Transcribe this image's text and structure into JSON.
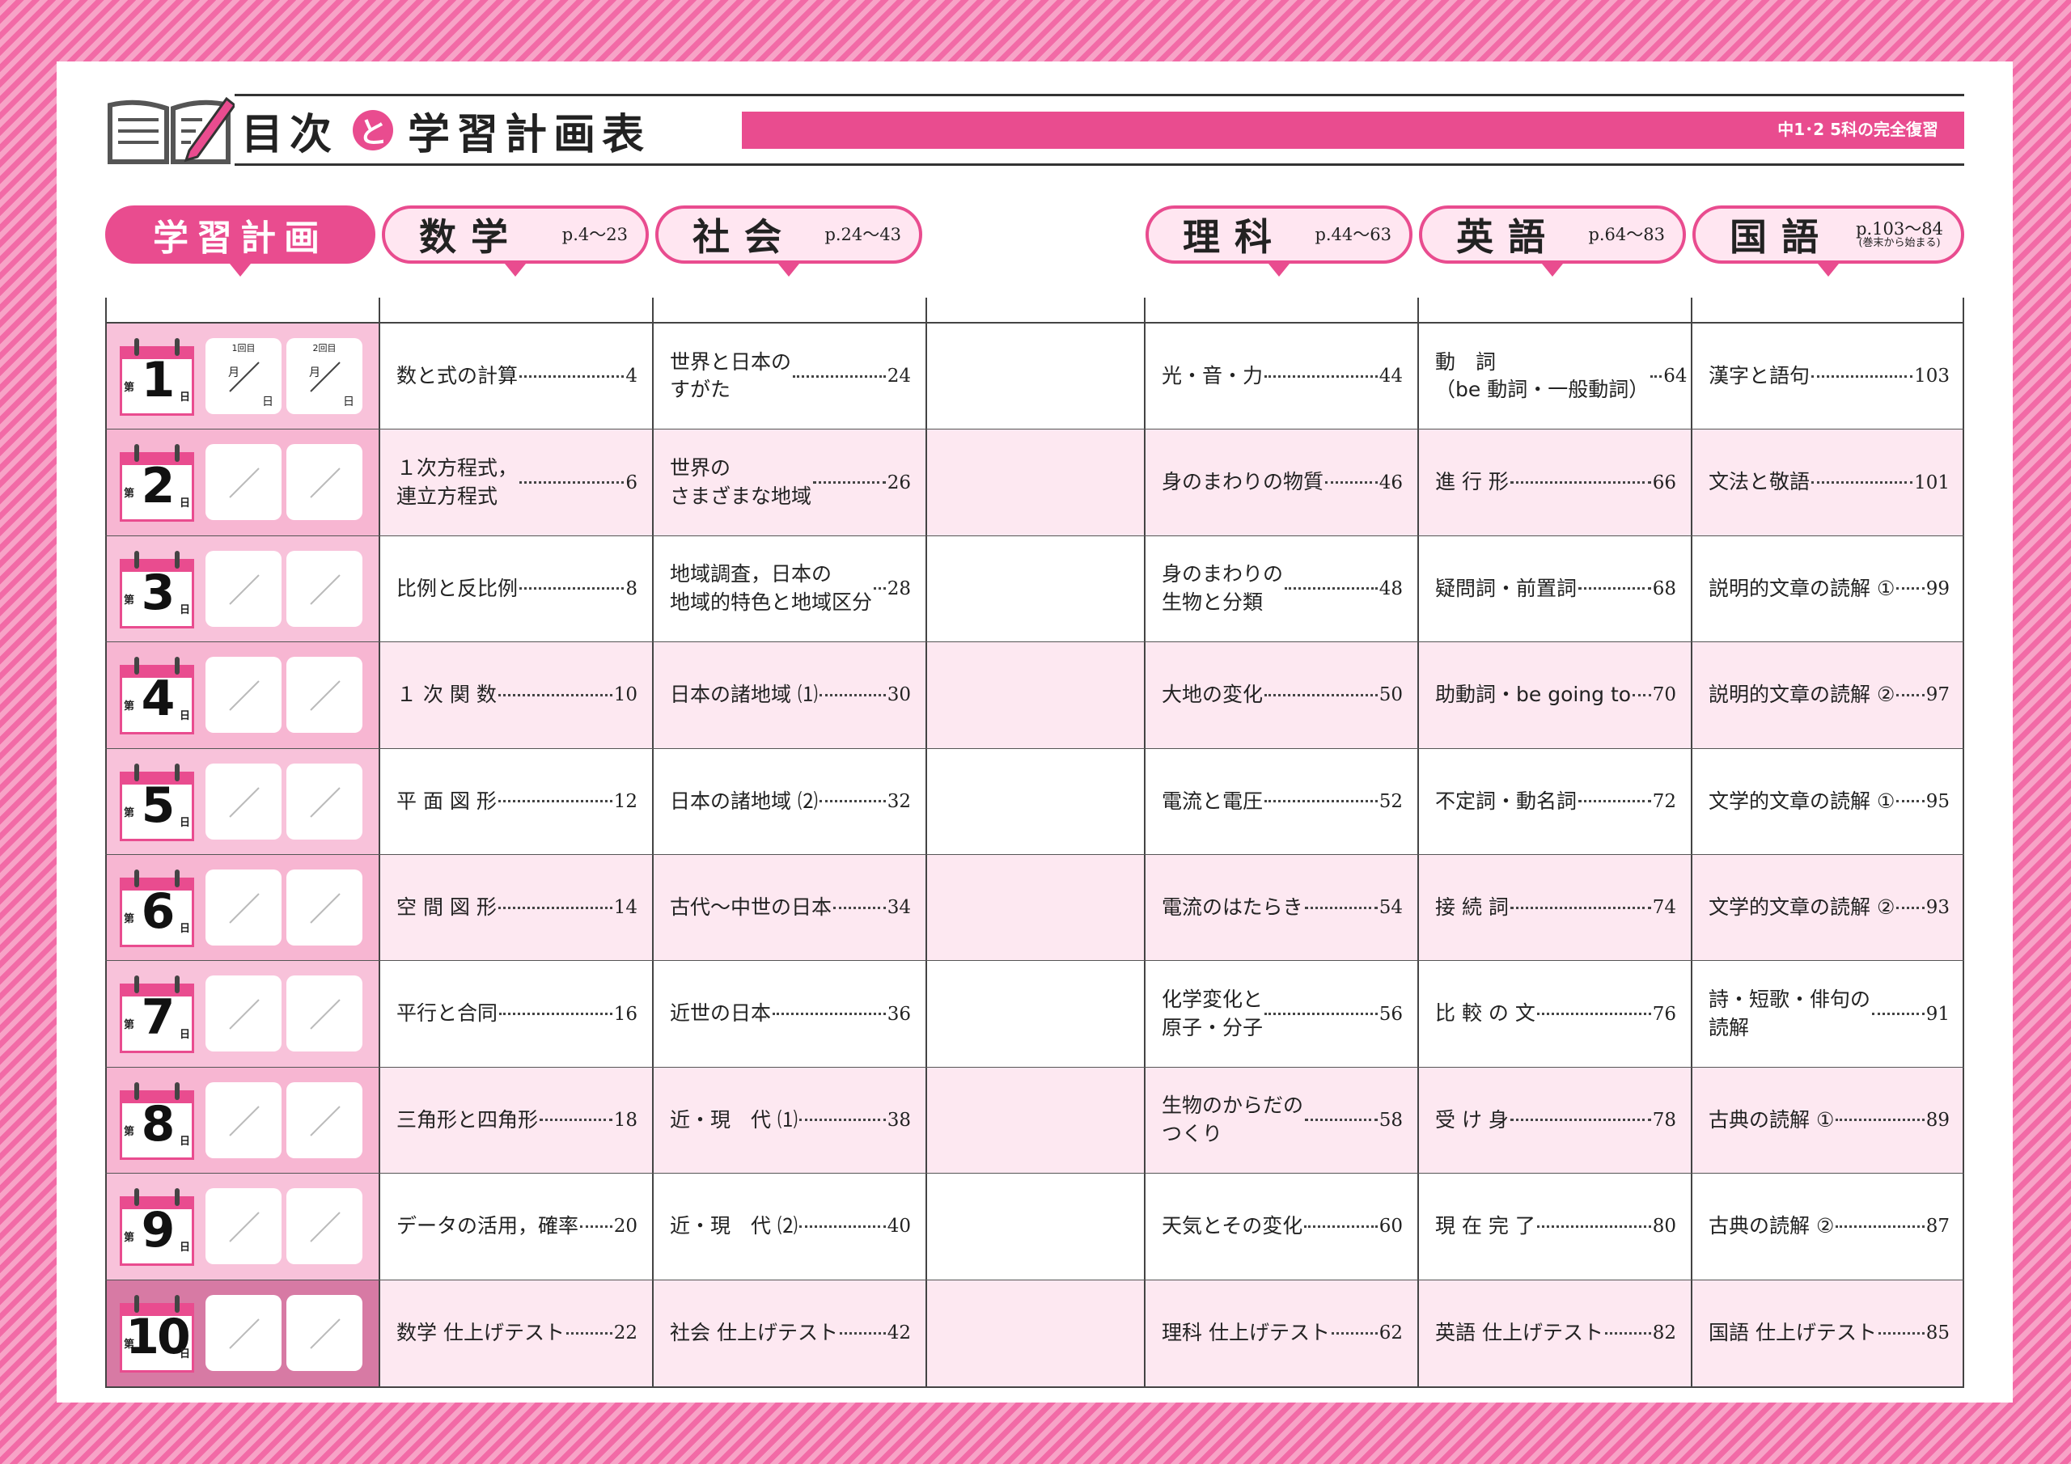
{
  "header": {
    "title_left": "目次",
    "title_mid": "と",
    "title_right": "学習計画表",
    "badge": "中1･2 5科の完全復習"
  },
  "plan_header": "学習計画",
  "date_labels": {
    "first": "1回目",
    "second": "2回目",
    "month": "月",
    "day": "日"
  },
  "calendar": {
    "prefix": "第",
    "suffix": "日"
  },
  "subjects": [
    {
      "name": "数学",
      "range": "p.4〜23",
      "note": ""
    },
    {
      "name": "社会",
      "range": "p.24〜43",
      "note": ""
    },
    {
      "name": "理科",
      "range": "p.44〜63",
      "note": ""
    },
    {
      "name": "英語",
      "range": "p.64〜83",
      "note": ""
    },
    {
      "name": "国語",
      "range": "p.103〜84",
      "note": "(巻末から始まる)"
    }
  ],
  "days": [
    "1",
    "2",
    "3",
    "4",
    "5",
    "6",
    "7",
    "8",
    "9",
    "10"
  ],
  "rows": [
    {
      "math": [
        "数と式の計算",
        "4"
      ],
      "social": [
        "世界と日本の\nすがた",
        "24"
      ],
      "science": [
        "光・音・力",
        "44"
      ],
      "english": [
        "動　詞\n（be 動詞・一般動詞）",
        "64"
      ],
      "japanese": [
        "漢字と語句",
        "103"
      ]
    },
    {
      "math": [
        "１次方程式，\n連立方程式",
        "6"
      ],
      "social": [
        "世界の\nさまざまな地域",
        "26"
      ],
      "science": [
        "身のまわりの物質",
        "46"
      ],
      "english": [
        "進 行 形",
        "66"
      ],
      "japanese": [
        "文法と敬語",
        "101"
      ]
    },
    {
      "math": [
        "比例と反比例",
        "8"
      ],
      "social": [
        "地域調査，日本の\n地域的特色と地域区分",
        "28"
      ],
      "science": [
        "身のまわりの\n生物と分類",
        "48"
      ],
      "english": [
        "疑問詞・前置詞",
        "68"
      ],
      "japanese": [
        "説明的文章の読解 ①",
        "99"
      ]
    },
    {
      "math": [
        "１ 次 関 数",
        "10"
      ],
      "social": [
        "日本の諸地域 ⑴",
        "30"
      ],
      "science": [
        "大地の変化",
        "50"
      ],
      "english": [
        "助動詞・be going to",
        "70"
      ],
      "japanese": [
        "説明的文章の読解 ②",
        "97"
      ]
    },
    {
      "math": [
        "平 面 図 形",
        "12"
      ],
      "social": [
        "日本の諸地域 ⑵",
        "32"
      ],
      "science": [
        "電流と電圧",
        "52"
      ],
      "english": [
        "不定詞・動名詞",
        "72"
      ],
      "japanese": [
        "文学的文章の読解 ①",
        "95"
      ]
    },
    {
      "math": [
        "空 間 図 形",
        "14"
      ],
      "social": [
        "古代〜中世の日本",
        "34"
      ],
      "science": [
        "電流のはたらき",
        "54"
      ],
      "english": [
        "接 続 詞",
        "74"
      ],
      "japanese": [
        "文学的文章の読解 ②",
        "93"
      ]
    },
    {
      "math": [
        "平行と合同",
        "16"
      ],
      "social": [
        "近世の日本",
        "36"
      ],
      "science": [
        "化学変化と\n原子・分子",
        "56"
      ],
      "english": [
        "比 較 の 文",
        "76"
      ],
      "japanese": [
        "詩・短歌・俳句の\n読解",
        "91"
      ]
    },
    {
      "math": [
        "三角形と四角形",
        "18"
      ],
      "social": [
        "近・現　代 ⑴",
        "38"
      ],
      "science": [
        "生物のからだの\nつくり",
        "58"
      ],
      "english": [
        "受 け 身",
        "78"
      ],
      "japanese": [
        "古典の読解 ①",
        "89"
      ]
    },
    {
      "math": [
        "データの活用，確率",
        "20"
      ],
      "social": [
        "近・現　代 ⑵",
        "40"
      ],
      "science": [
        "天気とその変化",
        "60"
      ],
      "english": [
        "現 在 完 了",
        "80"
      ],
      "japanese": [
        "古典の読解 ②",
        "87"
      ]
    },
    {
      "math": [
        "数学 仕上げテスト",
        "22"
      ],
      "social": [
        "社会 仕上げテスト",
        "42"
      ],
      "science": [
        "理科 仕上げテスト",
        "62"
      ],
      "english": [
        "英語 仕上げテスト",
        "82"
      ],
      "japanese": [
        "国語 仕上げテスト",
        "85"
      ]
    }
  ],
  "colors": {
    "accent": "#e94c8f",
    "row_alt": "#fde8f1",
    "plan_bg": "#f7b6d2"
  }
}
